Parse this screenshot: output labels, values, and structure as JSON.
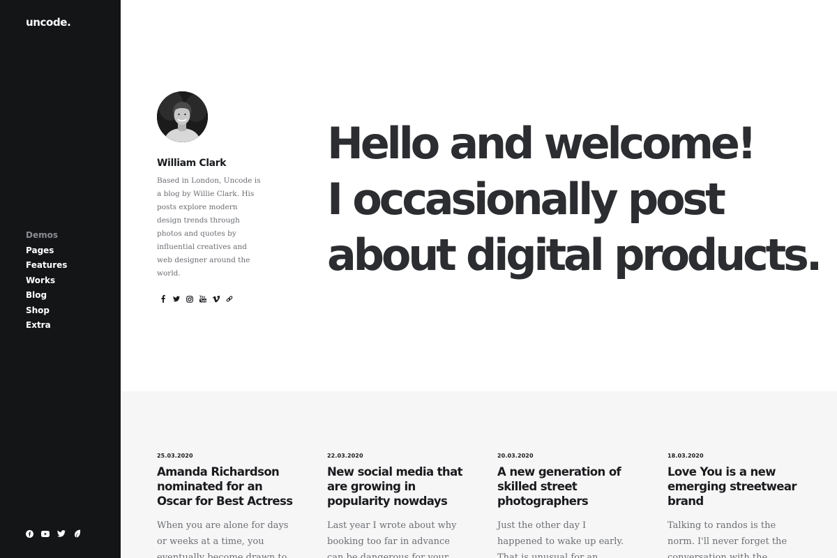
{
  "brand": {
    "logo": "uncode."
  },
  "sidebar": {
    "nav": [
      {
        "label": "Demos",
        "active": false
      },
      {
        "label": "Pages"
      },
      {
        "label": "Features"
      },
      {
        "label": "Works"
      },
      {
        "label": "Blog"
      },
      {
        "label": "Shop"
      },
      {
        "label": "Extra"
      }
    ],
    "social_icons": [
      "facebook-icon",
      "youtube-icon",
      "twitter-icon",
      "leaf-icon"
    ]
  },
  "author": {
    "name": "William Clark",
    "bio": "Based in London, Uncode is a blog by Willie Clark. His posts explore modern design trends through photos and quotes by influential creatives and web designer around the world.",
    "social_icons": [
      "facebook-icon",
      "twitter-icon",
      "instagram-icon",
      "youtube-icon",
      "vimeo-icon",
      "link-icon"
    ]
  },
  "hero": {
    "lines": [
      "Hello and welcome!",
      "I occasionally post",
      "about digital products."
    ]
  },
  "posts": [
    {
      "date": "25.03.2020",
      "title": "Amanda Richardson nominated for an Oscar for Best Actress",
      "excerpt": "When you are alone for days or weeks at a time, you eventually become drawn to people"
    },
    {
      "date": "22.03.2020",
      "title": "New social media that are growing in popularity nowdays",
      "excerpt": "Last year I wrote about why booking too far in advance can be dangerous for your"
    },
    {
      "date": "20.03.2020",
      "title": "A new generation of skilled street photographers",
      "excerpt": "Just the other day I happened to wake up early. That is unusual for an engineering"
    },
    {
      "date": "18.03.2020",
      "title": "Love You is a new emerging streetwear brand",
      "excerpt": "Talking to randos is the norm. I'll never forget the conversation with the"
    }
  ],
  "colors": {
    "sidebar_bg": "#141517",
    "headline": "#2c2d30",
    "posts_bg": "#f6f6f6",
    "muted_text": "#6b6d72"
  }
}
